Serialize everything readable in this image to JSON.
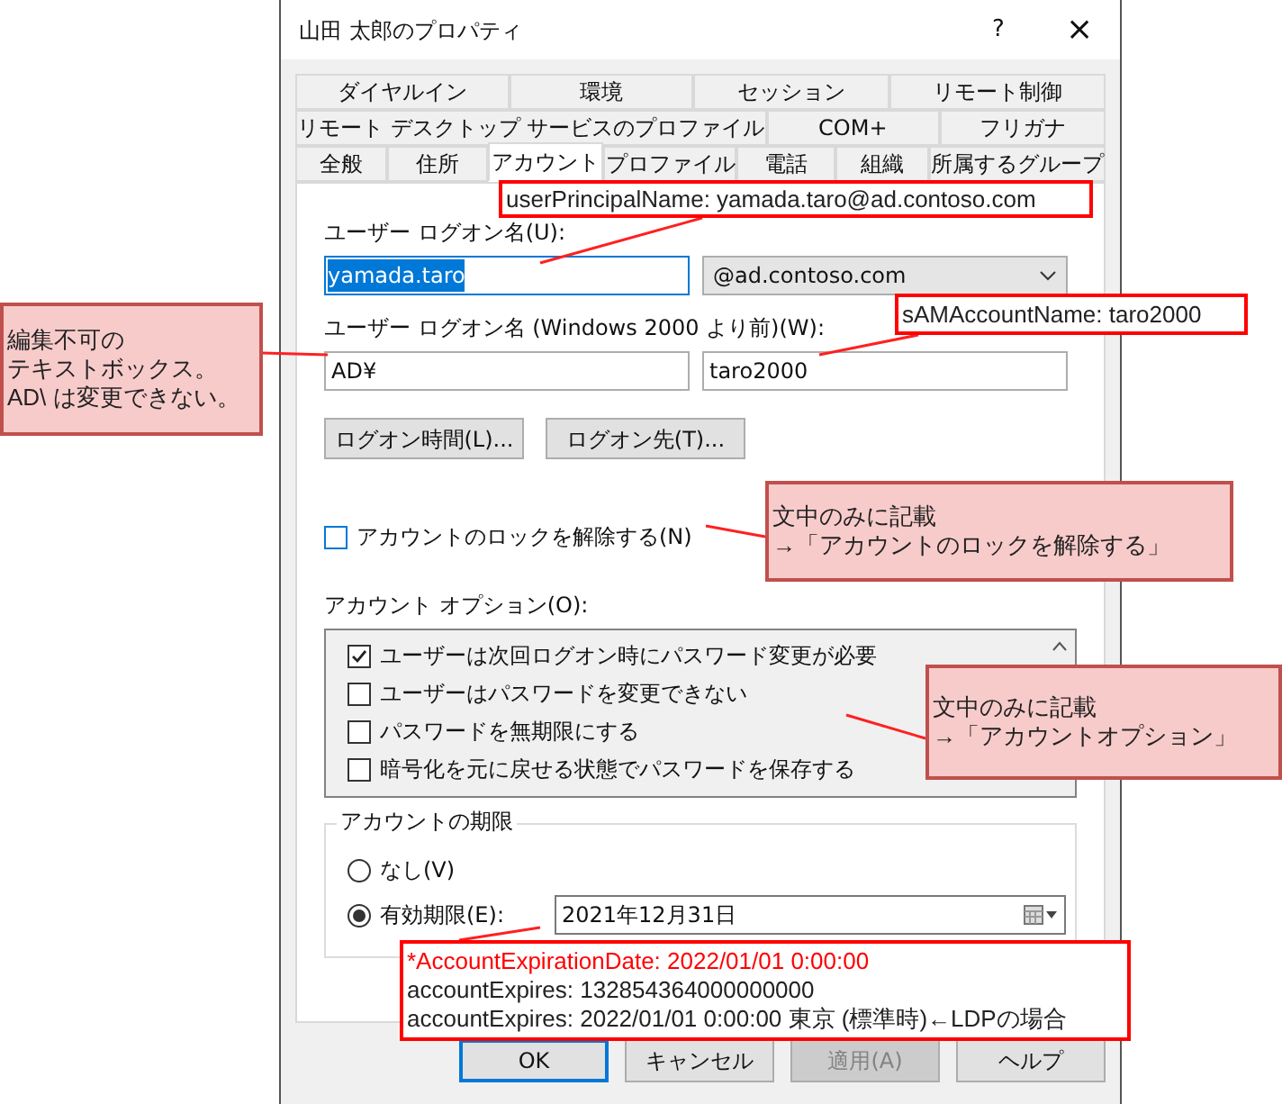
{
  "window": {
    "title": "山田 太郎のプロパティ",
    "help_button": "?",
    "close_button": "×"
  },
  "tab_rows": [
    [
      {
        "label": "ダイヤルイン",
        "selected": false
      },
      {
        "label": "環境",
        "selected": false
      },
      {
        "label": "セッション",
        "selected": false
      },
      {
        "label": "リモート制御",
        "selected": false
      }
    ],
    [
      {
        "label": "リモート デスクトップ サービスのプロファイル",
        "selected": false
      },
      {
        "label": "COM+",
        "selected": false
      },
      {
        "label": "フリガナ",
        "selected": false
      }
    ],
    [
      {
        "label": "全般",
        "selected": false
      },
      {
        "label": "住所",
        "selected": false
      },
      {
        "label": "アカウント",
        "selected": true
      },
      {
        "label": "プロファイル",
        "selected": false
      },
      {
        "label": "電話",
        "selected": false
      },
      {
        "label": "組織",
        "selected": false
      },
      {
        "label": "所属するグループ",
        "selected": false
      }
    ]
  ],
  "logon_name": {
    "label": "ユーザー ログオン名(U):",
    "value": "yamada.taro",
    "value_selected": true,
    "domain": "@ad.contoso.com"
  },
  "pre2000_logon_name": {
    "label": "ユーザー ログオン名 (Windows 2000 より前)(W):",
    "domain": "AD¥",
    "value": "taro2000"
  },
  "logon_buttons": [
    "ログオン時間(L)...",
    "ログオン先(T)..."
  ],
  "unlock": {
    "label": "アカウントのロックを解除する(N)",
    "checked": false
  },
  "account_options": {
    "label": "アカウント オプション(O):",
    "items": [
      {
        "label": "ユーザーは次回ログオン時にパスワード変更が必要",
        "checked": true
      },
      {
        "label": "ユーザーはパスワードを変更できない",
        "checked": false
      },
      {
        "label": "パスワードを無期限にする",
        "checked": false
      },
      {
        "label": "暗号化を元に戻せる状態でパスワードを保存する",
        "checked": false
      }
    ]
  },
  "account_expiry": {
    "title": "アカウントの期限",
    "options": [
      {
        "label": "なし(V)",
        "selected": false
      },
      {
        "label": "有効期限(E):",
        "selected": true
      }
    ],
    "date": "2021年12月31日"
  },
  "dialog_buttons": [
    {
      "label": "OK",
      "default": true,
      "disabled": false
    },
    {
      "label": "キャンセル",
      "default": false,
      "disabled": false
    },
    {
      "label": "適用(A)",
      "default": false,
      "disabled": true
    },
    {
      "label": "ヘルプ",
      "default": false,
      "disabled": false
    }
  ],
  "callouts": [
    {
      "kind": "frame",
      "lines": [
        {
          "text": "userPrincipalName: yamada.taro@ad.contoso.com",
          "emphasis": false
        }
      ]
    },
    {
      "kind": "note",
      "lines": [
        {
          "text": "編集不可の",
          "emphasis": false
        },
        {
          "text": "テキストボックス。",
          "emphasis": false
        },
        {
          "text": "AD\\ は変更できない。",
          "emphasis": false
        }
      ]
    },
    {
      "kind": "frame",
      "lines": [
        {
          "text": "sAMAccountName: taro2000",
          "emphasis": false
        }
      ]
    },
    {
      "kind": "note",
      "lines": [
        {
          "text": "文中のみに記載",
          "emphasis": false
        },
        {
          "text": "→「アカウントのロックを解除する」",
          "emphasis": false
        }
      ]
    },
    {
      "kind": "note",
      "lines": [
        {
          "text": "文中のみに記載",
          "emphasis": false
        },
        {
          "text": "→「アカウントオプション」",
          "emphasis": false
        }
      ]
    },
    {
      "kind": "frame",
      "lines": [
        {
          "text": "*AccountExpirationDate: 2022/01/01 0:00:00",
          "emphasis": true
        },
        {
          "text": "accountExpires: 132854364000000000",
          "emphasis": false
        },
        {
          "text": "accountExpires: 2022/01/01 0:00:00 東京 (標準時)←LDPの場合",
          "emphasis": false
        }
      ]
    }
  ]
}
